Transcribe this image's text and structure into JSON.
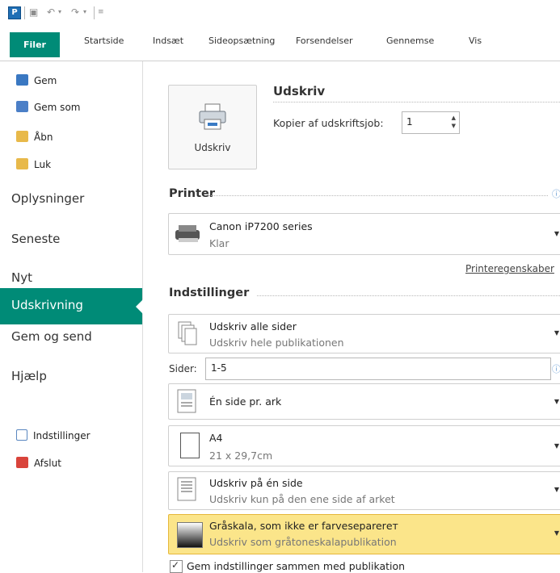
{
  "quick_access": {
    "app_icon_label": "P"
  },
  "tabs": [
    {
      "label": "Filer"
    },
    {
      "label": "Startside"
    },
    {
      "label": "Indsæt"
    },
    {
      "label": "Sideopsætning"
    },
    {
      "label": "Forsendelser"
    },
    {
      "label": "Gennemse"
    },
    {
      "label": "Vis"
    }
  ],
  "nav": {
    "small_top": [
      {
        "label": "Gem",
        "icon": "save-icon"
      },
      {
        "label": "Gem som",
        "icon": "save-as-icon"
      },
      {
        "label": "Åbn",
        "icon": "open-folder-icon"
      },
      {
        "label": "Luk",
        "icon": "close-folder-icon"
      }
    ],
    "big": [
      {
        "label": "Oplysninger"
      },
      {
        "label": "Seneste"
      },
      {
        "label": "Nyt"
      },
      {
        "label": "Udskrivning"
      },
      {
        "label": "Gem og send"
      },
      {
        "label": "Hjælp"
      }
    ],
    "small_bottom": [
      {
        "label": "Indstillinger",
        "icon": "options-icon"
      },
      {
        "label": "Afslut",
        "icon": "exit-icon"
      }
    ],
    "active": "Udskrivning"
  },
  "print": {
    "button_label": "Udskriv",
    "heading": "Udskriv",
    "copies_label": "Kopier af udskriftsjob:",
    "copies_value": "1"
  },
  "printer": {
    "section": "Printer",
    "name": "Canon iP7200 series",
    "status": "Klar",
    "properties_link": "Printeregenskaber"
  },
  "settings": {
    "section": "Indstillinger",
    "range_title": "Udskriv alle sider",
    "range_sub": "Udskriv hele publikationen",
    "pages_label": "Sider:",
    "pages_value": "1-5",
    "layout_title": "Én side pr. ark",
    "paper_title": "A4",
    "paper_sub": "21 x 29,7cm",
    "sides_title": "Udskriv på én side",
    "sides_sub": "Udskriv kun på den ene side af arket",
    "color_title": "Gråskala, som ikke er farveseparerет",
    "color_sub": "Udskriv som gråtoneskalapublikation",
    "save_with_pub": "Gem indstillinger sammen med publikation",
    "save_with_pub_checked": true
  },
  "colors": {
    "accent": "#008b77",
    "highlight": "#fbe58a"
  }
}
